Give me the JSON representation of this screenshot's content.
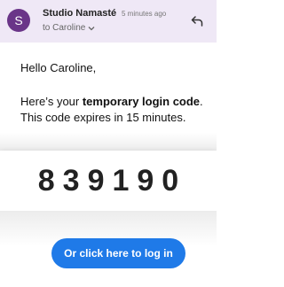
{
  "email": {
    "sender_initial": "S",
    "sender_name": "Studio Namasté",
    "time": "5 minutes ago",
    "recipient": "to Caroline",
    "icons": {
      "avatar": "avatar",
      "recipient_expand": "chevron-down-icon",
      "reply": "reply-icon"
    }
  },
  "body": {
    "greeting": "Hello Caroline,",
    "line1_prefix": "Here’s your ",
    "line1_bold": "temporary login code",
    "line1_suffix": ".",
    "line2": "This code expires in 15 minutes.",
    "code": "839190",
    "login_button": "Or click here to log in"
  },
  "colors": {
    "header_bg": "#efe8f6",
    "avatar_bg": "#6a3588",
    "button_bg": "#1f7ae8"
  }
}
